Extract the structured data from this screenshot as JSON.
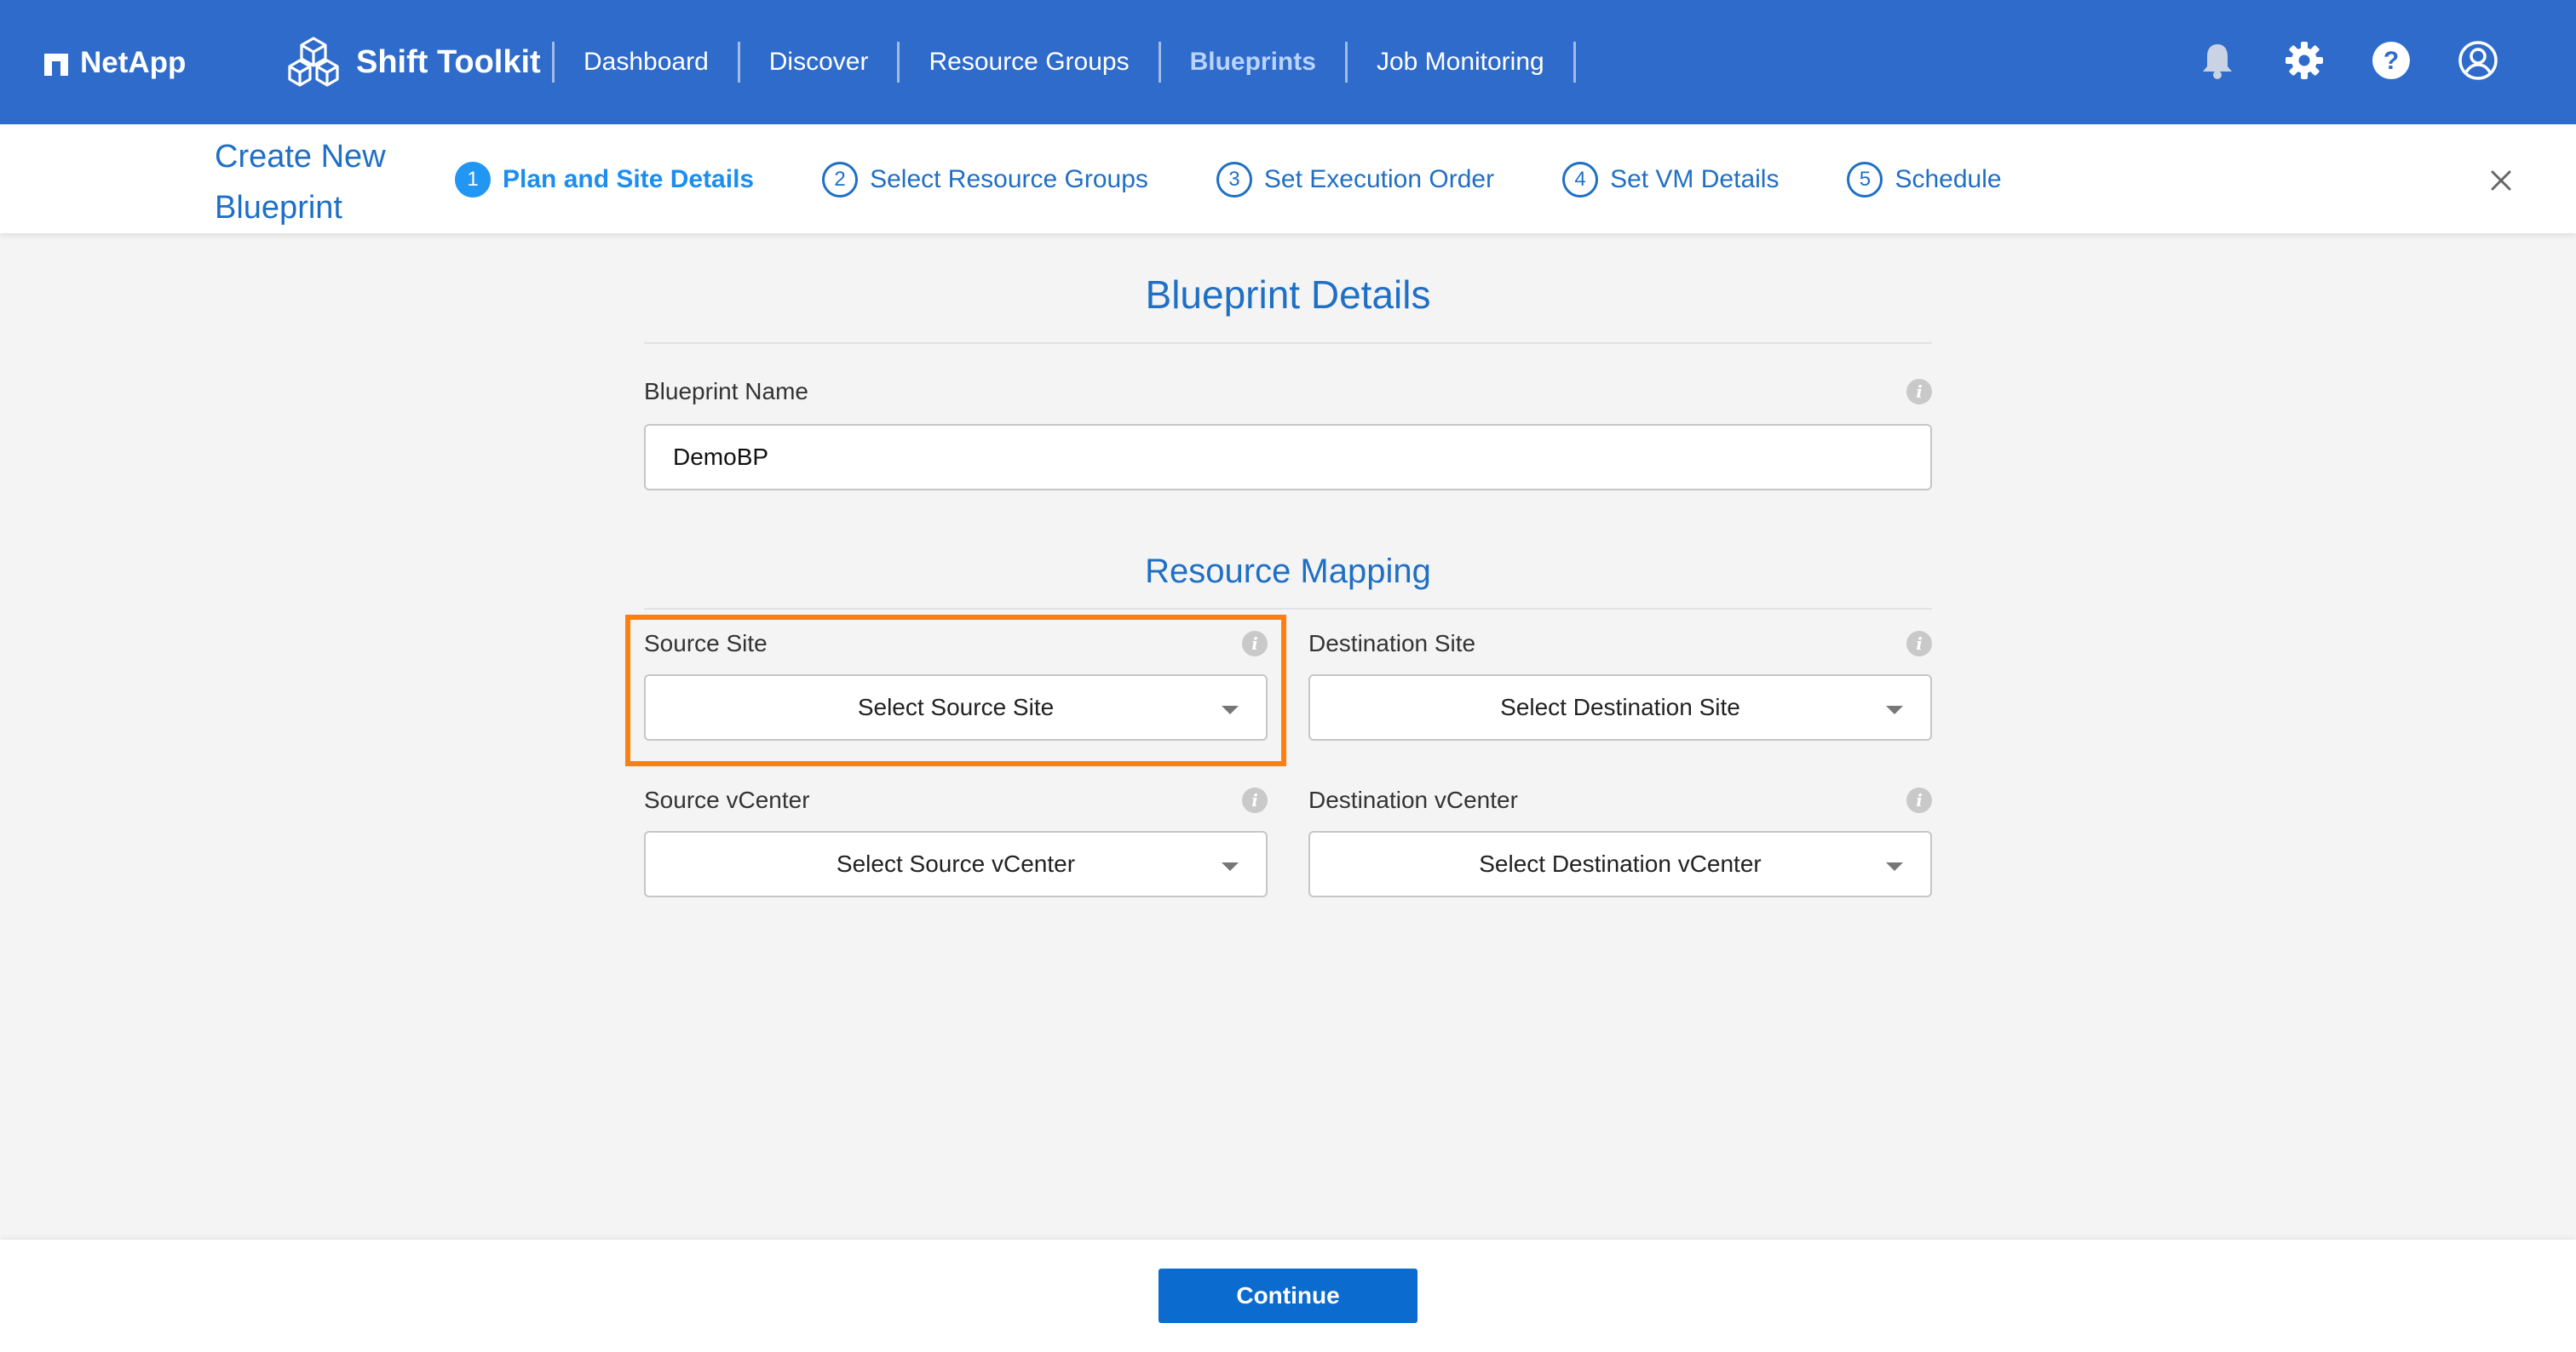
{
  "header": {
    "brand": "NetApp",
    "app_title": "Shift Toolkit",
    "nav": [
      {
        "label": "Dashboard"
      },
      {
        "label": "Discover"
      },
      {
        "label": "Resource Groups"
      },
      {
        "label": "Blueprints",
        "active": true
      },
      {
        "label": "Job Monitoring"
      }
    ],
    "icons": [
      "bell-icon",
      "gear-icon",
      "help-icon",
      "user-icon"
    ]
  },
  "wizard": {
    "title": "Create New Blueprint",
    "steps": [
      {
        "num": "1",
        "label": "Plan and Site Details",
        "active": true
      },
      {
        "num": "2",
        "label": "Select Resource Groups"
      },
      {
        "num": "3",
        "label": "Set Execution Order"
      },
      {
        "num": "4",
        "label": "Set VM Details"
      },
      {
        "num": "5",
        "label": "Schedule"
      }
    ]
  },
  "form": {
    "heading": "Blueprint Details",
    "name_label": "Blueprint Name",
    "name_value": "DemoBP",
    "mapping_heading": "Resource Mapping",
    "source_site_label": "Source Site",
    "source_site_value": "Select Source Site",
    "dest_site_label": "Destination Site",
    "dest_site_value": "Select Destination Site",
    "source_vcenter_label": "Source vCenter",
    "source_vcenter_value": "Select Source vCenter",
    "dest_vcenter_label": "Destination vCenter",
    "dest_vcenter_value": "Select Destination vCenter"
  },
  "footer": {
    "continue_label": "Continue"
  },
  "colors": {
    "header_bg": "#2f6bcb",
    "accent": "#1f6fc5",
    "highlight": "#ff7f0e",
    "button": "#0b6bcf"
  }
}
